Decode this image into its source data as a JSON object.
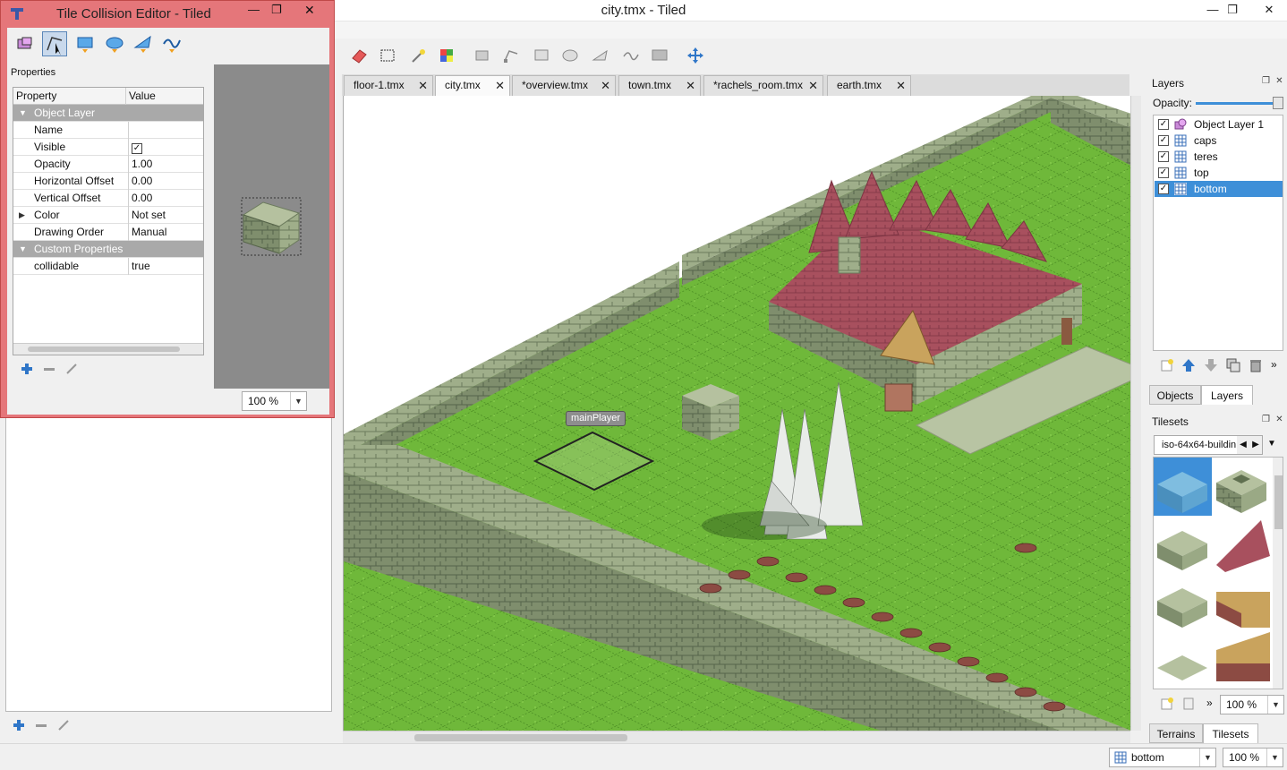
{
  "main_window": {
    "title": "city.tmx - Tiled"
  },
  "tabs": [
    {
      "label": "floor-1.tmx",
      "active": false
    },
    {
      "label": "city.tmx",
      "active": true
    },
    {
      "label": "*overview.tmx",
      "active": false
    },
    {
      "label": "town.tmx",
      "active": false
    },
    {
      "label": "*rachels_room.tmx",
      "active": false
    },
    {
      "label": "earth.tmx",
      "active": false
    }
  ],
  "tab_close_glyph": "✕",
  "map": {
    "object_label": "mainPlayer"
  },
  "layers_panel": {
    "title": "Layers",
    "opacity_label": "Opacity:",
    "opacity_value": 1.0,
    "layers": [
      {
        "name": "Object Layer 1",
        "icon": "object-layer-icon",
        "visible": true,
        "selected": false
      },
      {
        "name": "caps",
        "icon": "tile-layer-icon",
        "visible": true,
        "selected": false
      },
      {
        "name": "teres",
        "icon": "tile-layer-icon",
        "visible": true,
        "selected": false
      },
      {
        "name": "top",
        "icon": "tile-layer-icon",
        "visible": true,
        "selected": false
      },
      {
        "name": "bottom",
        "icon": "tile-layer-icon",
        "visible": true,
        "selected": true
      }
    ],
    "tabs": [
      "Objects",
      "Layers"
    ],
    "active_tab": "Layers"
  },
  "tilesets_panel": {
    "title": "Tilesets",
    "current_tileset": "iso-64x64-buildin",
    "zoom": "100 %",
    "tabs": [
      "Terrains",
      "Tilesets"
    ],
    "active_tab": "Tilesets"
  },
  "status_bar": {
    "layer": "bottom",
    "zoom": "100 %"
  },
  "collision_editor": {
    "title": "Tile Collision Editor - Tiled",
    "properties_label": "Properties",
    "columns": [
      "Property",
      "Value"
    ],
    "rows": [
      {
        "type": "group",
        "key": "Object Layer",
        "value": ""
      },
      {
        "type": "prop",
        "key": "Name",
        "value": ""
      },
      {
        "type": "prop",
        "key": "Visible",
        "value": "✓"
      },
      {
        "type": "prop",
        "key": "Opacity",
        "value": "1.00"
      },
      {
        "type": "prop",
        "key": "Horizontal Offset",
        "value": "0.00"
      },
      {
        "type": "prop",
        "key": "Vertical Offset",
        "value": "0.00"
      },
      {
        "type": "prop-expand",
        "key": "Color",
        "value": "Not set"
      },
      {
        "type": "prop",
        "key": "Drawing Order",
        "value": "Manual"
      },
      {
        "type": "group",
        "key": "Custom Properties",
        "value": ""
      },
      {
        "type": "prop",
        "key": "collidable",
        "value": "true"
      }
    ],
    "zoom": "100 %"
  },
  "colors": {
    "selection": "#3e8fd8",
    "grass": "#6fb83a",
    "wall": "#a7b592",
    "roof": "#a8505e",
    "dialog_frame": "#e5767a"
  }
}
